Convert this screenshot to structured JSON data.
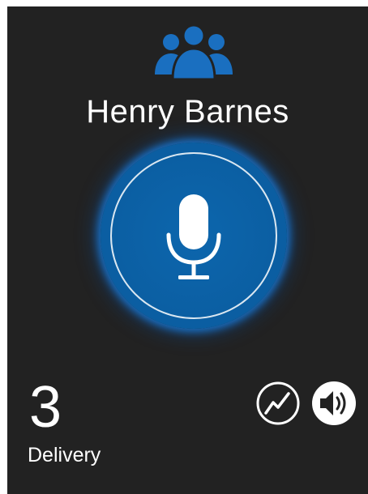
{
  "contact": {
    "name": "Henry Barnes",
    "type_icon": "group-icon"
  },
  "ptt": {
    "icon": "microphone-icon",
    "accent_color": "#0b62a8"
  },
  "stats": {
    "count": "3",
    "label": "Delivery"
  },
  "controls": {
    "activity_icon": "activity-icon",
    "speaker_icon": "speaker-icon"
  },
  "colors": {
    "background": "#222222",
    "accent": "#0b62a8",
    "group_icon": "#1a6fc0",
    "text": "#ffffff"
  }
}
